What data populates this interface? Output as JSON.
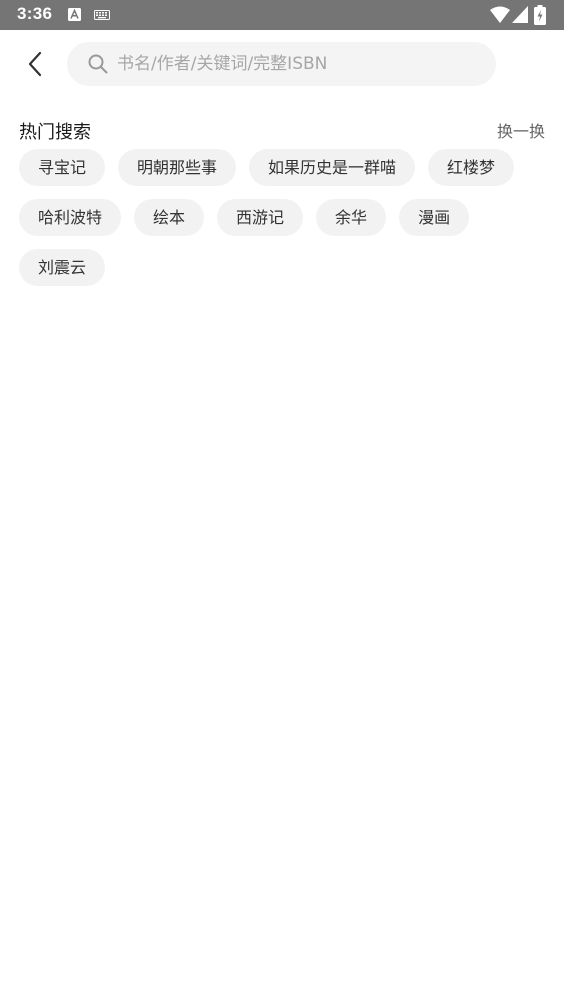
{
  "status_bar": {
    "time": "3:36",
    "notification_icons": [
      "a-icon",
      "keyboard-icon"
    ],
    "right_icons": [
      "wifi-icon",
      "signal-icon",
      "battery-charging-icon"
    ]
  },
  "search": {
    "placeholder": "书名/作者/关键词/完整ISBN",
    "value": ""
  },
  "hot_search": {
    "title": "热门搜索",
    "refresh_label": "换一换",
    "tags": [
      "寻宝记",
      "明朝那些事",
      "如果历史是一群喵",
      "红楼梦",
      "哈利波特",
      "绘本",
      "西游记",
      "余华",
      "漫画",
      "刘震云"
    ]
  }
}
